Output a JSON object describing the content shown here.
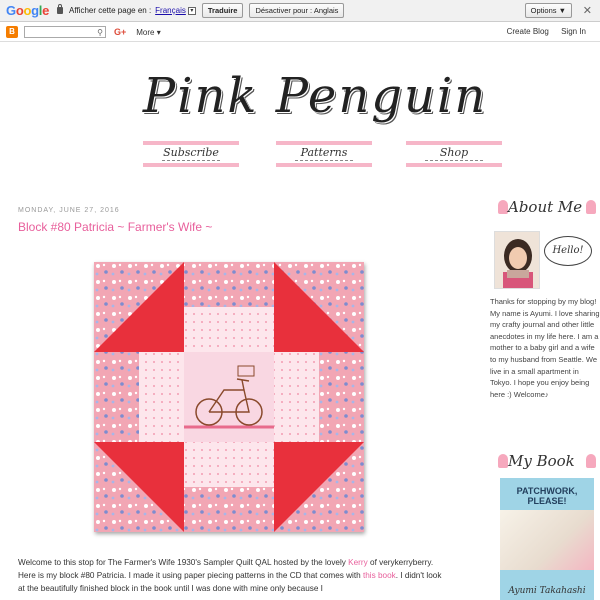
{
  "translate_bar": {
    "logo": "Google",
    "prompt": "Afficher cette page en :",
    "language": "Français",
    "translate_button": "Traduire",
    "disable_button": "Désactiver pour : Anglais",
    "options_button": "Options ▼",
    "close": "✕"
  },
  "navbar": {
    "logo": "B",
    "search_icon": "⚲",
    "gplus": "G+",
    "more": "More ▾",
    "create_blog": "Create Blog",
    "sign_in": "Sign In"
  },
  "header": {
    "title": "Pink Penguin",
    "tabs": [
      {
        "label": "Subscribe"
      },
      {
        "label": "Patterns"
      },
      {
        "label": "Shop"
      }
    ]
  },
  "post": {
    "date": "MONDAY, JUNE 27, 2016",
    "title": "Block #80 Patricia ~ Farmer's Wife ~",
    "body_1": "Welcome to this stop for The Farmer's Wife 1930's Sampler Quilt QAL hosted by the lovely ",
    "link_kerry": "Kerry",
    "body_2": " of verykerryberry. Here is my block #80 Patricia. I made it using paper piecing patterns in the CD that comes with ",
    "link_book": "this book",
    "body_3": ". I didn't look at the beautifully finished block in the book until I was done with mine only because I"
  },
  "sidebar": {
    "about_title": "About Me",
    "hello": "Hello!",
    "about_text": "Thanks for stopping by my blog! My name is Ayumi. I love sharing my crafty journal and other little anecdotes in my life here. I am a mother to a baby girl and a wife to my husband from Seattle. We live in a small apartment in Tokyo. I hope you enjoy being here :) Welcome♪",
    "book_title": "My Book",
    "book_cover_title": "PATCHWORK, PLEASE!",
    "book_author": "Ayumi Takahashi"
  },
  "colors": {
    "accent_pink": "#e8609c",
    "tab_stripe": "#f6b6c8",
    "quilt_red": "#e8303c",
    "quilt_pink_print": "#f2a6b4"
  }
}
